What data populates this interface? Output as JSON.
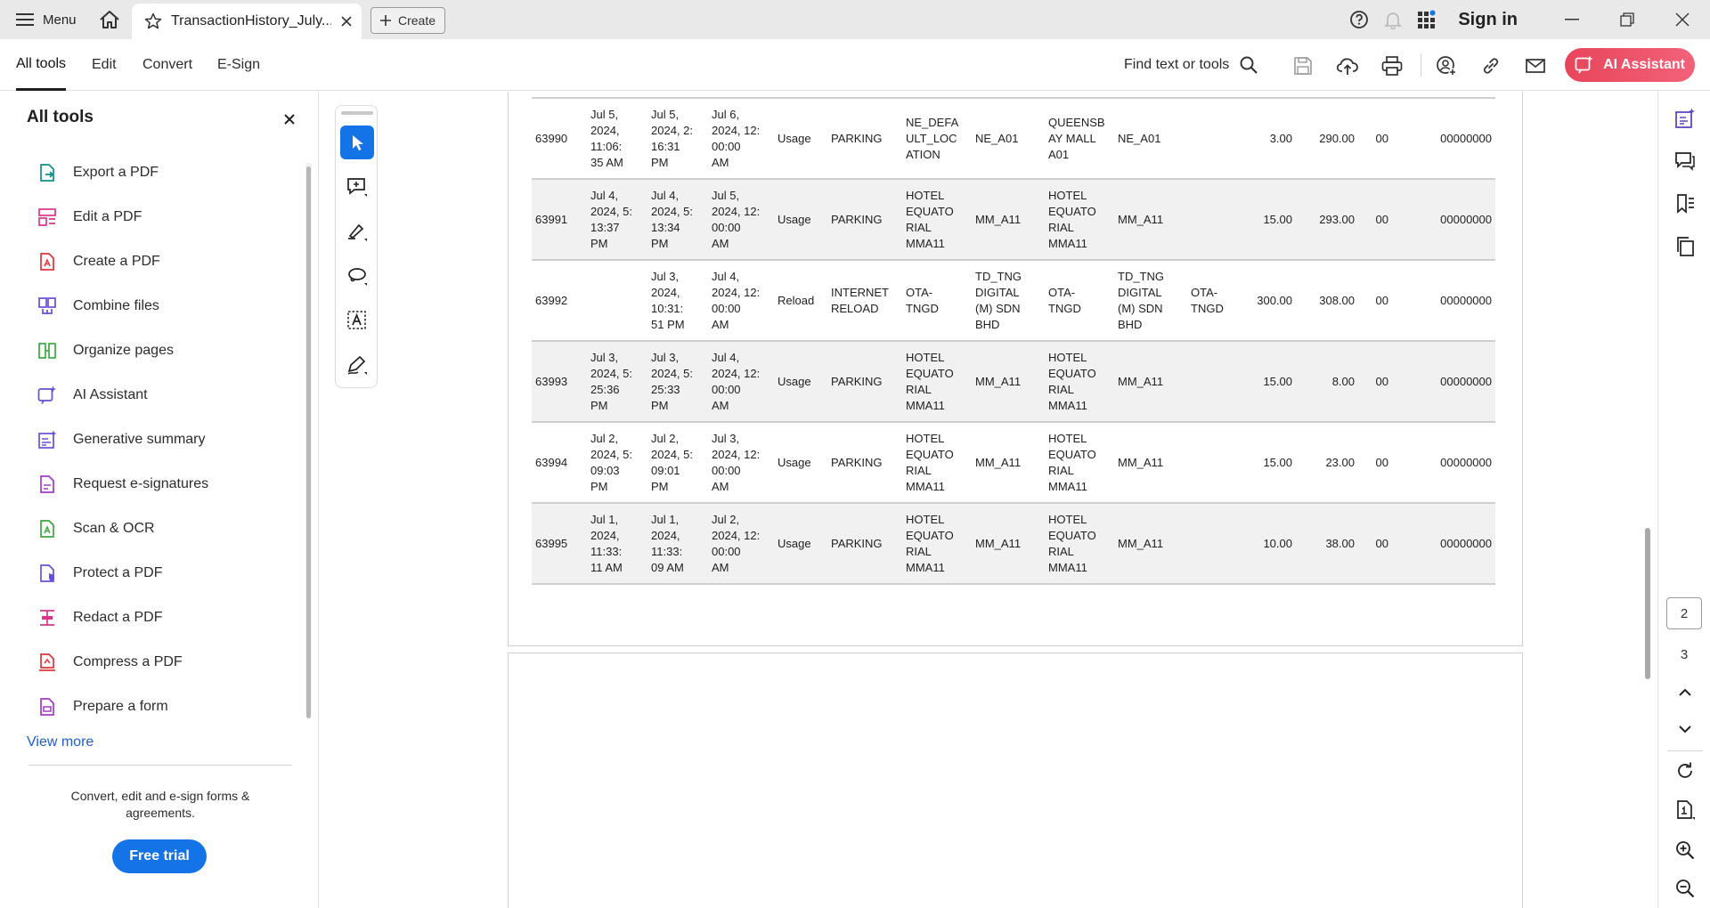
{
  "titlebar": {
    "menu_label": "Menu",
    "tab_title": "TransactionHistory_July...",
    "create_label": "Create",
    "sign_in": "Sign in"
  },
  "toolbar": {
    "tabs": [
      "All tools",
      "Edit",
      "Convert",
      "E-Sign"
    ],
    "find_placeholder": "Find text or tools",
    "ai_assistant": "AI Assistant"
  },
  "left_panel": {
    "title": "All tools",
    "items": [
      {
        "label": "Export a PDF",
        "icon": "export-pdf-icon"
      },
      {
        "label": "Edit a PDF",
        "icon": "edit-pdf-icon"
      },
      {
        "label": "Create a PDF",
        "icon": "create-pdf-icon"
      },
      {
        "label": "Combine files",
        "icon": "combine-files-icon"
      },
      {
        "label": "Organize pages",
        "icon": "organize-pages-icon"
      },
      {
        "label": "AI Assistant",
        "icon": "ai-assistant-icon"
      },
      {
        "label": "Generative summary",
        "icon": "generative-summary-icon"
      },
      {
        "label": "Request e-signatures",
        "icon": "request-esign-icon"
      },
      {
        "label": "Scan & OCR",
        "icon": "scan-ocr-icon"
      },
      {
        "label": "Protect a PDF",
        "icon": "protect-pdf-icon"
      },
      {
        "label": "Redact a PDF",
        "icon": "redact-pdf-icon"
      },
      {
        "label": "Compress a PDF",
        "icon": "compress-pdf-icon"
      },
      {
        "label": "Prepare a form",
        "icon": "prepare-form-icon"
      }
    ],
    "view_more": "View more",
    "promo_text": "Convert, edit and e-sign forms & agreements.",
    "free_trial": "Free trial"
  },
  "document": {
    "rows": [
      [
        "63990",
        "Jul 5,\n2024,\n11:06:\n35 AM",
        "Jul 5,\n2024, 2:\n16:31\nPM",
        "Jul 6,\n2024, 12:\n00:00\nAM",
        "Usage",
        "PARKING",
        "NE_DEFA\nULT_LOC\nATION",
        "NE_A01",
        "QUEENSB\nAY MALL\nA01",
        "NE_A01",
        "",
        "3.00",
        "290.00",
        "00",
        "00000000"
      ],
      [
        "63991",
        "Jul 4,\n2024, 5:\n13:37\nPM",
        "Jul 4,\n2024, 5:\n13:34\nPM",
        "Jul 5,\n2024, 12:\n00:00\nAM",
        "Usage",
        "PARKING",
        "HOTEL\nEQUATO\nRIAL\nMMA11",
        "MM_A11",
        "HOTEL\nEQUATO\nRIAL\nMMA11",
        "MM_A11",
        "",
        "15.00",
        "293.00",
        "00",
        "00000000"
      ],
      [
        "63992",
        "",
        "Jul 3,\n2024,\n10:31:\n51 PM",
        "Jul 4,\n2024, 12:\n00:00\nAM",
        "Reload",
        "INTERNET\nRELOAD",
        "OTA-\nTNGD",
        "TD_TNG\nDIGITAL\n(M) SDN\nBHD",
        "OTA-\nTNGD",
        "TD_TNG\nDIGITAL\n(M) SDN\nBHD",
        "OTA-\nTNGD",
        "300.00",
        "308.00",
        "00",
        "00000000"
      ],
      [
        "63993",
        "Jul 3,\n2024, 5:\n25:36\nPM",
        "Jul 3,\n2024, 5:\n25:33\nPM",
        "Jul 4,\n2024, 12:\n00:00\nAM",
        "Usage",
        "PARKING",
        "HOTEL\nEQUATO\nRIAL\nMMA11",
        "MM_A11",
        "HOTEL\nEQUATO\nRIAL\nMMA11",
        "MM_A11",
        "",
        "15.00",
        "8.00",
        "00",
        "00000000"
      ],
      [
        "63994",
        "Jul 2,\n2024, 5:\n09:03\nPM",
        "Jul 2,\n2024, 5:\n09:01\nPM",
        "Jul 3,\n2024, 12:\n00:00\nAM",
        "Usage",
        "PARKING",
        "HOTEL\nEQUATO\nRIAL\nMMA11",
        "MM_A11",
        "HOTEL\nEQUATO\nRIAL\nMMA11",
        "MM_A11",
        "",
        "15.00",
        "23.00",
        "00",
        "00000000"
      ],
      [
        "63995",
        "Jul 1,\n2024,\n11:33:\n11 AM",
        "Jul 1,\n2024,\n11:33:\n09 AM",
        "Jul 2,\n2024, 12:\n00:00\nAM",
        "Usage",
        "PARKING",
        "HOTEL\nEQUATO\nRIAL\nMMA11",
        "MM_A11",
        "HOTEL\nEQUATO\nRIAL\nMMA11",
        "MM_A11",
        "",
        "10.00",
        "38.00",
        "00",
        "00000000"
      ]
    ]
  },
  "right_rail": {
    "current_page": "2",
    "next_page": "3"
  },
  "colors": {
    "accent_blue": "#1473e6",
    "ai_gradient_start": "#e8455a",
    "ai_gradient_end": "#f2627a",
    "link_blue": "#1d5fd1",
    "rail_icon_purple": "#5c4ac4"
  }
}
